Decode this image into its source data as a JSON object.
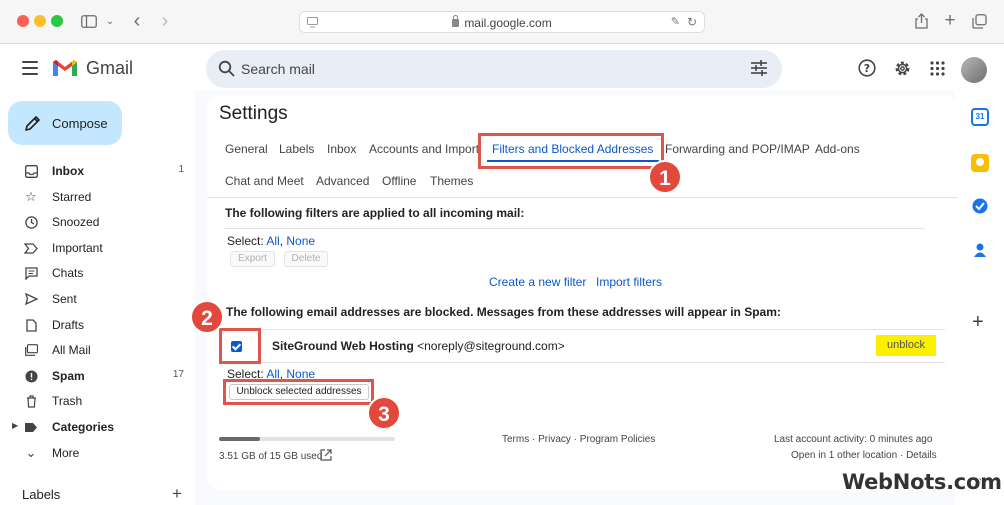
{
  "browser": {
    "url": "mail.google.com"
  },
  "app": {
    "name": "Gmail"
  },
  "search": {
    "placeholder": "Search mail"
  },
  "compose": {
    "label": "Compose"
  },
  "sidebar": {
    "items": [
      {
        "label": "Inbox",
        "count": "1",
        "icon": "inbox-icon",
        "bold": true
      },
      {
        "label": "Starred",
        "count": "",
        "icon": "star-icon",
        "bold": false
      },
      {
        "label": "Snoozed",
        "count": "",
        "icon": "clock-icon",
        "bold": false
      },
      {
        "label": "Important",
        "count": "",
        "icon": "important-icon",
        "bold": false
      },
      {
        "label": "Chats",
        "count": "",
        "icon": "chat-icon",
        "bold": false
      },
      {
        "label": "Sent",
        "count": "",
        "icon": "send-icon",
        "bold": false
      },
      {
        "label": "Drafts",
        "count": "",
        "icon": "draft-icon",
        "bold": false
      },
      {
        "label": "All Mail",
        "count": "",
        "icon": "all-mail-icon",
        "bold": false
      },
      {
        "label": "Spam",
        "count": "17",
        "icon": "spam-icon",
        "bold": true
      },
      {
        "label": "Trash",
        "count": "",
        "icon": "trash-icon",
        "bold": false
      },
      {
        "label": "Categories",
        "count": "",
        "icon": "label-icon",
        "bold": true
      },
      {
        "label": "More",
        "count": "",
        "icon": "chevron-down-icon",
        "bold": false
      }
    ],
    "labels_heading": "Labels"
  },
  "settings": {
    "title": "Settings",
    "tabs_row1": [
      "General",
      "Labels",
      "Inbox",
      "Accounts and Import",
      "Filters and Blocked Addresses",
      "Forwarding and POP/IMAP",
      "Add-ons"
    ],
    "tabs_row2": [
      "Chat and Meet",
      "Advanced",
      "Offline",
      "Themes"
    ],
    "filters_heading": "The following filters are applied to all incoming mail:",
    "select_label": "Select:",
    "select_all": "All",
    "select_none": "None",
    "export_label": "Export",
    "delete_label": "Delete",
    "create_filter": "Create a new filter",
    "import_filters": "Import filters",
    "blocked_heading": "The following email addresses are blocked. Messages from these addresses will appear in Spam:",
    "blocked_name": "SiteGround Web Hosting",
    "blocked_email": "<noreply@siteground.com>",
    "unblock_label": "unblock",
    "unblock_selected": "Unblock selected addresses",
    "storage_text": "3.51 GB of 15 GB used",
    "storage_fraction": 0.234,
    "footer_links": "Terms · Privacy · Program Policies",
    "last_activity": "Last account activity: 0 minutes ago",
    "open_location": "Open in 1 other location · Details"
  },
  "annotations": {
    "badge1": "1",
    "badge2": "2",
    "badge3": "3"
  },
  "watermark": "WebNots.com",
  "colors": {
    "accent": "#0b57d0",
    "highlight": "#faf000",
    "annotation": "#e2483c",
    "compose_bg": "#c2e7ff"
  }
}
